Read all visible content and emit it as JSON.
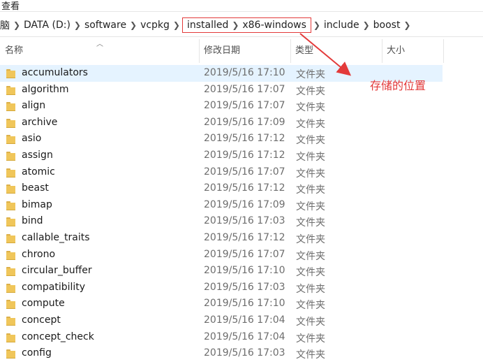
{
  "window": {
    "title": "查看"
  },
  "address": {
    "crumbs": [
      "脑",
      "DATA (D:)",
      "software",
      "vcpkg"
    ],
    "highlighted": [
      "installed",
      "x86-windows"
    ],
    "after": [
      "include",
      "boost"
    ]
  },
  "columns": {
    "name": "名称",
    "date": "修改日期",
    "type": "类型",
    "size": "大小"
  },
  "annotation": "存储的位置",
  "colors": {
    "highlight_box": "#e33a3a",
    "selected_row": "#e5f3ff",
    "folder": "#f0c65a"
  },
  "rows": [
    {
      "name": "accumulators",
      "date": "2019/5/16 17:10",
      "type": "文件夹"
    },
    {
      "name": "algorithm",
      "date": "2019/5/16 17:07",
      "type": "文件夹"
    },
    {
      "name": "align",
      "date": "2019/5/16 17:07",
      "type": "文件夹"
    },
    {
      "name": "archive",
      "date": "2019/5/16 17:09",
      "type": "文件夹"
    },
    {
      "name": "asio",
      "date": "2019/5/16 17:12",
      "type": "文件夹"
    },
    {
      "name": "assign",
      "date": "2019/5/16 17:12",
      "type": "文件夹"
    },
    {
      "name": "atomic",
      "date": "2019/5/16 17:07",
      "type": "文件夹"
    },
    {
      "name": "beast",
      "date": "2019/5/16 17:12",
      "type": "文件夹"
    },
    {
      "name": "bimap",
      "date": "2019/5/16 17:09",
      "type": "文件夹"
    },
    {
      "name": "bind",
      "date": "2019/5/16 17:03",
      "type": "文件夹"
    },
    {
      "name": "callable_traits",
      "date": "2019/5/16 17:12",
      "type": "文件夹"
    },
    {
      "name": "chrono",
      "date": "2019/5/16 17:07",
      "type": "文件夹"
    },
    {
      "name": "circular_buffer",
      "date": "2019/5/16 17:10",
      "type": "文件夹"
    },
    {
      "name": "compatibility",
      "date": "2019/5/16 17:03",
      "type": "文件夹"
    },
    {
      "name": "compute",
      "date": "2019/5/16 17:10",
      "type": "文件夹"
    },
    {
      "name": "concept",
      "date": "2019/5/16 17:04",
      "type": "文件夹"
    },
    {
      "name": "concept_check",
      "date": "2019/5/16 17:04",
      "type": "文件夹"
    },
    {
      "name": "config",
      "date": "2019/5/16 17:03",
      "type": "文件夹"
    }
  ]
}
